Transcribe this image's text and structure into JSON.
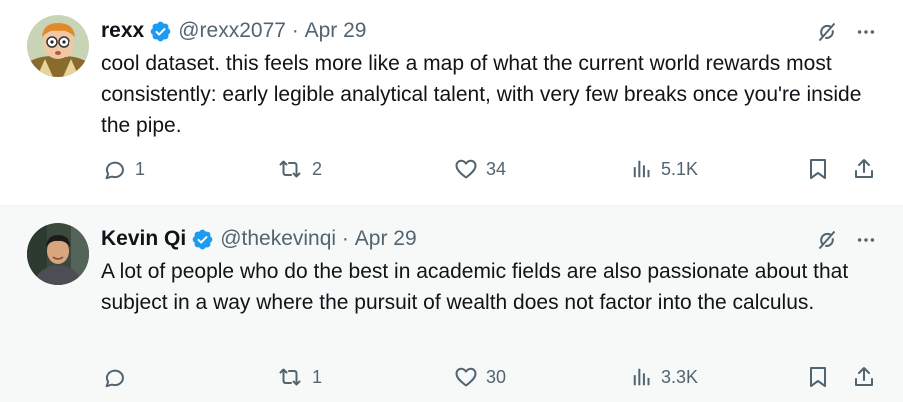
{
  "colors": {
    "accent": "#1d9bf0",
    "text": "#0f1419",
    "muted": "#536471",
    "separator": "#eff3f4",
    "second_bg": "#f7f9f9"
  },
  "tweets": [
    {
      "display_name": "rexx",
      "handle": "@rexx2077",
      "date": "Apr 29",
      "text": "cool dataset. this feels more like a map of what the current world rewards most consistently: early legible analytical talent, with very few breaks once you're inside the pipe.",
      "replies": "1",
      "reposts": "2",
      "likes": "34",
      "views": "5.1K",
      "icons": [
        "verified-badge-icon",
        "grok-icon",
        "more-icon",
        "reply-icon",
        "repost-icon",
        "like-icon",
        "views-icon",
        "bookmark-icon",
        "share-icon"
      ]
    },
    {
      "display_name": "Kevin Qi",
      "handle": "@thekevinqi",
      "date": "Apr 29",
      "text": "A lot of people who do the best in academic fields are also passionate about that subject in a way where the pursuit of wealth does not factor into the calculus.",
      "replies": "",
      "reposts": "1",
      "likes": "30",
      "views": "3.3K",
      "icons": [
        "verified-badge-icon",
        "grok-icon",
        "more-icon",
        "reply-icon",
        "repost-icon",
        "like-icon",
        "views-icon",
        "bookmark-icon",
        "share-icon"
      ]
    }
  ],
  "separator": " · "
}
